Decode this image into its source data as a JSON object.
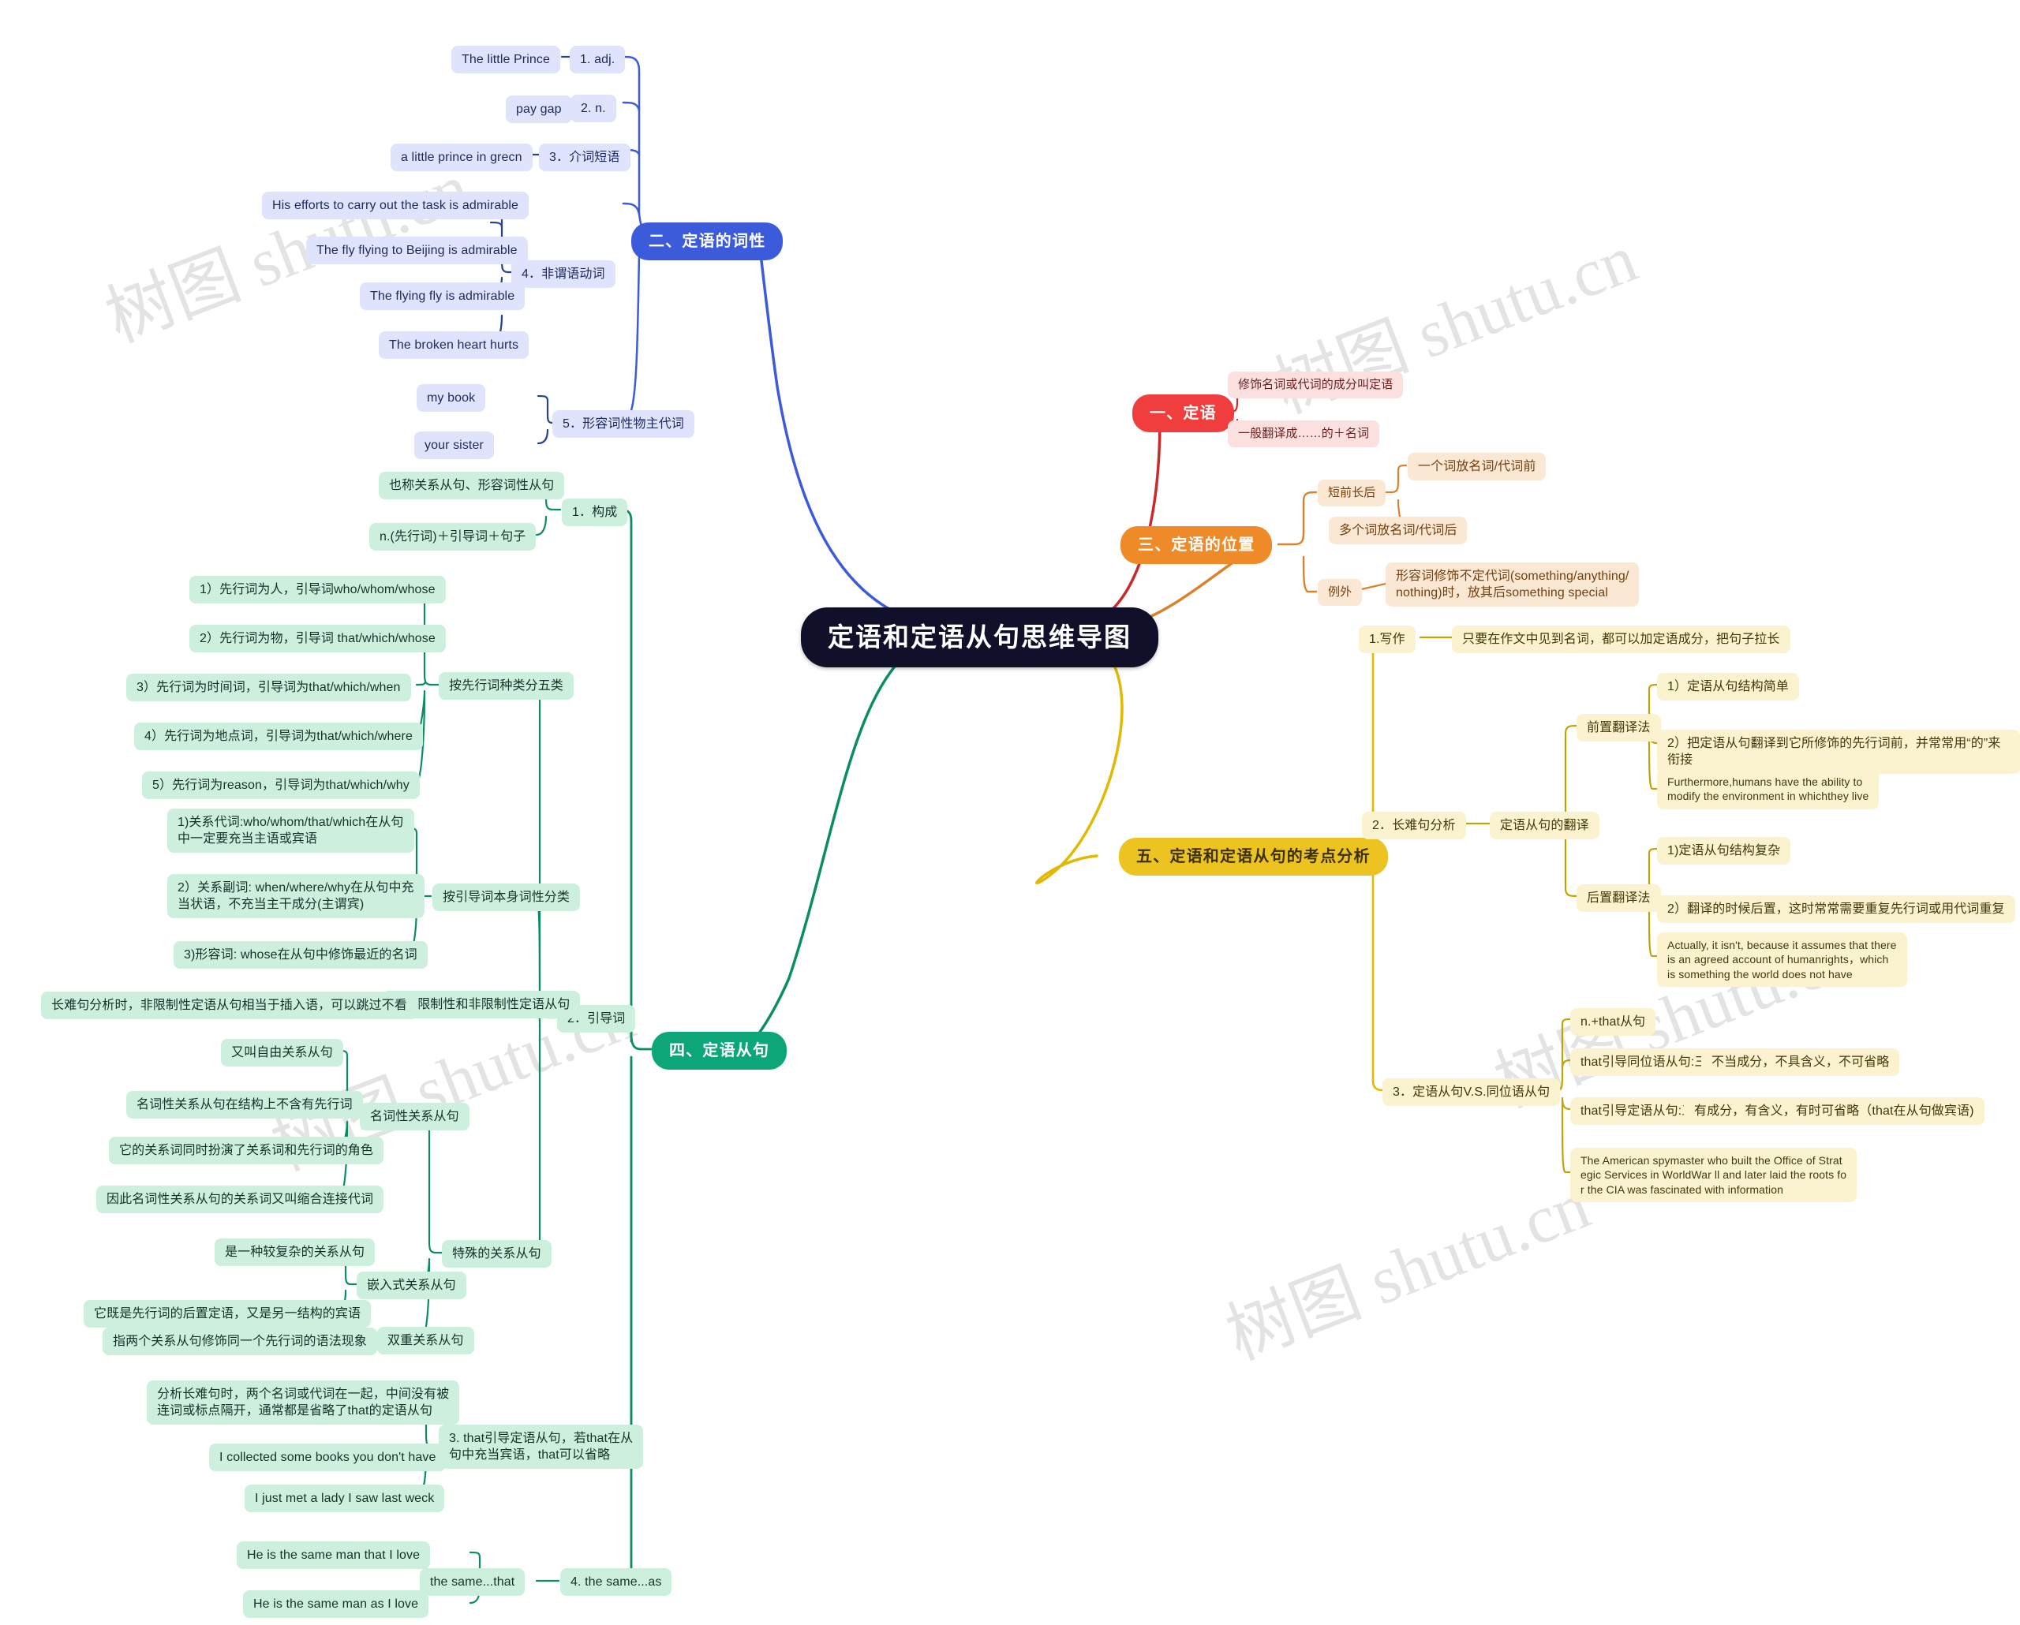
{
  "root": {
    "title": "定语和定语从句思维导图"
  },
  "watermark": {
    "text": "树图 shutu.cn"
  },
  "colors": {
    "root_bg": "#10102b",
    "blue": "#3b5bdb",
    "red": "#f03e3e",
    "orange": "#ef8a28",
    "green": "#0ca678",
    "yellow": "#edc321"
  },
  "branch_blue": {
    "title": "二、定语的词性",
    "items": [
      {
        "label": "1. adj.",
        "children": [
          "The little Prince"
        ]
      },
      {
        "label": "2. n.",
        "children": [
          "pay gap"
        ]
      },
      {
        "label": "3．介词短语",
        "children": [
          "a little prince in grecn"
        ]
      },
      {
        "label": "4．非谓语动词",
        "children": [
          "His efforts to carry out the task is admirable",
          "The fly flying to Beijing is admirable",
          "The flying fly is admirable",
          "The broken heart hurts"
        ]
      },
      {
        "label": "5．形容词性物主代词",
        "children": [
          "my book",
          "your sister"
        ]
      }
    ]
  },
  "branch_red": {
    "title": "一、定语",
    "items": [
      "修饰名词或代词的成分叫定语",
      "一般翻译成……的＋名词"
    ]
  },
  "branch_orange": {
    "title": "三、定语的位置",
    "items": [
      {
        "label": "短前长后",
        "children": [
          "一个词放名词/代词前",
          "多个词放名词/代词后"
        ]
      },
      {
        "label": "例外",
        "children": [
          "形容词修饰不定代词(something/anything/\nnothing)时，放其后something special"
        ]
      }
    ]
  },
  "branch_yellow": {
    "title": "五、定语和定语从句的考点分析",
    "items": [
      {
        "label": "1.写作",
        "children": [
          "只要在作文中见到名词，都可以加定语成分，把句子拉长"
        ]
      },
      {
        "label": "2．长难句分析",
        "mid": "定语从句的翻译",
        "groups": [
          {
            "label": "前置翻译法",
            "children": [
              "1）定语从句结构简单",
              "2）把定语从句翻译到它所修饰的先行词前，并常常用“的”来衔接",
              "Furthermore,humans have the ability to\nmodify the environment in whichthey live"
            ]
          },
          {
            "label": "后置翻译法",
            "children": [
              "1)定语从句结构复杂",
              "2）翻译的时候后置，这时常常需要重复先行词或用代词重复",
              "Actually, it isn't, because it assumes that there\n is an agreed account of humanrights，which\nis something the world does not have"
            ]
          }
        ]
      },
      {
        "label": "3．定语从句V.S.同位语从句",
        "children": [
          {
            "text": "n.+that从句",
            "note": ""
          },
          {
            "text": "that引导同位语从句:三不原则",
            "note": "不当成分，不具含义，不可省略"
          },
          {
            "text": "that引导定语从句:三有原则",
            "note": "有成分，有含义，有时可省略（that在从句做宾语)"
          },
          {
            "text": "The American spymaster who built the Office of Strat\negic Services in WorldWar ll and later laid the roots fo\nr the CIA was fascinated with information",
            "note": ""
          }
        ]
      }
    ]
  },
  "branch_green": {
    "title": "四、定语从句",
    "g1": {
      "label": "1．构成",
      "children": [
        "也称关系从句、形容词性从句",
        "n.(先行词)＋引导词＋句子"
      ]
    },
    "g2": {
      "label": "2．引导词",
      "sub1": {
        "label": "按先行词种类分五类",
        "children": [
          "1）先行词为人，引导词who/whom/whose",
          "2）先行词为物，引导词 that/which/whose",
          "3）先行词为时间词，引导词为that/which/when",
          "4）先行词为地点词，引导词为that/which/where",
          "5）先行词为reason，引导词为that/which/why"
        ]
      },
      "sub2": {
        "label": "按引导词本身词性分类",
        "children": [
          "1)关系代词:who/whom/that/which在从句\n中一定要充当主语或宾语",
          "2）关系副词: when/where/why在从句中充\n当状语，不充当主干成分(主谓宾)",
          "3)形容词: whose在从句中修饰最近的名词"
        ]
      },
      "sub3": {
        "label": "区分限制性和非限制性定语从句",
        "children": [
          "长难句分析时，非限制性定语从句相当于插入语，可以跳过不看"
        ]
      },
      "sub4": {
        "label": "特殊的关系从句",
        "groups": [
          {
            "label": "名词性关系从句",
            "children": [
              "又叫自由关系从句",
              "名词性关系从句在结构上不含有先行词",
              "它的关系词同时扮演了关系词和先行词的角色",
              "因此名词性关系从句的关系词又叫缩合连接代词"
            ]
          },
          {
            "label": "嵌入式关系从句",
            "children": [
              "是一种较复杂的关系从句",
              "它既是先行词的后置定语，又是另一结构的宾语"
            ]
          },
          {
            "label": "双重关系从句",
            "children": [
              "指两个关系从句修饰同一个先行词的语法现象"
            ]
          }
        ]
      }
    },
    "g3": {
      "label": "3. that引导定语从句，若that在从\n句中充当宾语，that可以省略",
      "children": [
        "分析长难句时，两个名词或代词在一起，中间没有被\n连词或标点隔开，通常都是省略了that的定语从句",
        "I collected some books you don't have",
        "I just met a lady I saw last weck"
      ]
    },
    "g4": {
      "label": "4. the same...as",
      "mid": "the same...that",
      "children": [
        "He is the same man that I love",
        "He is the same man as I love"
      ]
    }
  }
}
